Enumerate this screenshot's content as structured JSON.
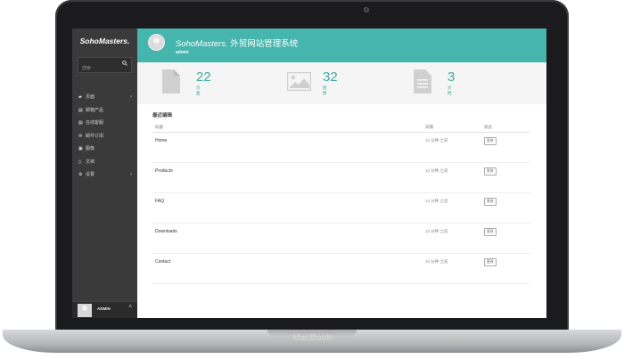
{
  "device": {
    "brand": "MacBook"
  },
  "sidebar": {
    "logo": "SohoMasters.",
    "search_placeholder": "搜索",
    "search_icon": "search-icon",
    "items": [
      {
        "icon": "folder-icon",
        "label": "页面",
        "has_chevron": true
      },
      {
        "icon": "document-icon",
        "label": "邮箱产品"
      },
      {
        "icon": "document-icon",
        "label": "在线客服"
      },
      {
        "icon": "envelope-icon",
        "label": "邮件订阅"
      },
      {
        "icon": "image-icon",
        "label": "图像"
      },
      {
        "icon": "file-icon",
        "label": "文档"
      },
      {
        "icon": "gears-icon",
        "label": "设置",
        "has_chevron": true
      }
    ],
    "user": {
      "name": "ADMIN"
    }
  },
  "header": {
    "brand": "SohoMasters.",
    "title_suffix": " 外贸网站管理系统",
    "username": "admin"
  },
  "stats": [
    {
      "icon": "page-icon",
      "value": "22",
      "label": "页面"
    },
    {
      "icon": "image-icon",
      "value": "32",
      "label": "图像"
    },
    {
      "icon": "document-icon",
      "value": "3",
      "label": "文档"
    }
  ],
  "recent": {
    "title": "最近编辑",
    "columns": {
      "title": "标题",
      "date": "日期",
      "status": "状态"
    },
    "rows": [
      {
        "title": "Home",
        "date": "12 分钟 之前",
        "action": "更改"
      },
      {
        "title": "Products",
        "date": "13 分钟 之前",
        "action": "更改"
      },
      {
        "title": "FAQ",
        "date": "13 分钟 之前",
        "action": "更改"
      },
      {
        "title": "Downloads",
        "date": "13 分钟 之前",
        "action": "更改"
      },
      {
        "title": "Contact",
        "date": "13 分钟 之前",
        "action": "更改"
      }
    ]
  },
  "colors": {
    "accent": "#45b5ad",
    "sidebar": "#3a3a3a",
    "stat_text": "#3ea9a2"
  }
}
